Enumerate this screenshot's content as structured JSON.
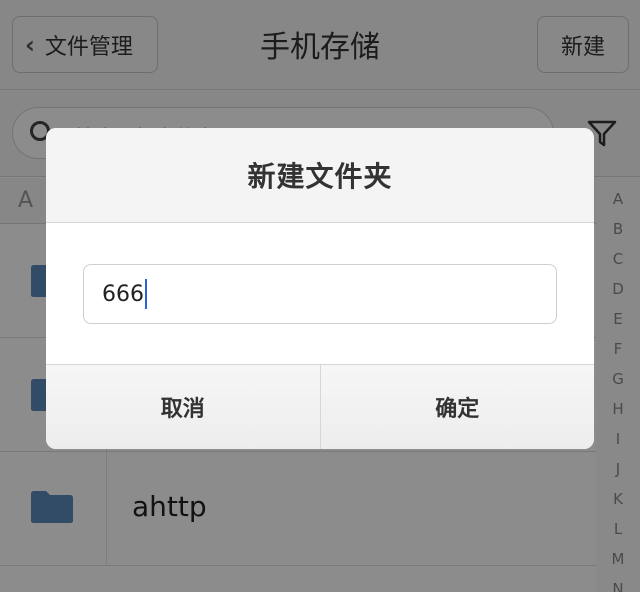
{
  "nav": {
    "back_label": "文件管理",
    "title": "手机存储",
    "new_label": "新建"
  },
  "search": {
    "placeholder": "搜索目标文件夹"
  },
  "list": {
    "section_letter": "A",
    "rows": [
      {
        "name": ""
      },
      {
        "name": ""
      },
      {
        "name": "ahttp"
      }
    ]
  },
  "index_letters": [
    "A",
    "B",
    "C",
    "D",
    "E",
    "F",
    "G",
    "H",
    "I",
    "J",
    "K",
    "L",
    "M",
    "N"
  ],
  "dialog": {
    "title": "新建文件夹",
    "input_value": "666",
    "cancel_label": "取消",
    "confirm_label": "确定"
  },
  "colors": {
    "folder": "#5b8bbd",
    "caret": "#2a62d9"
  }
}
